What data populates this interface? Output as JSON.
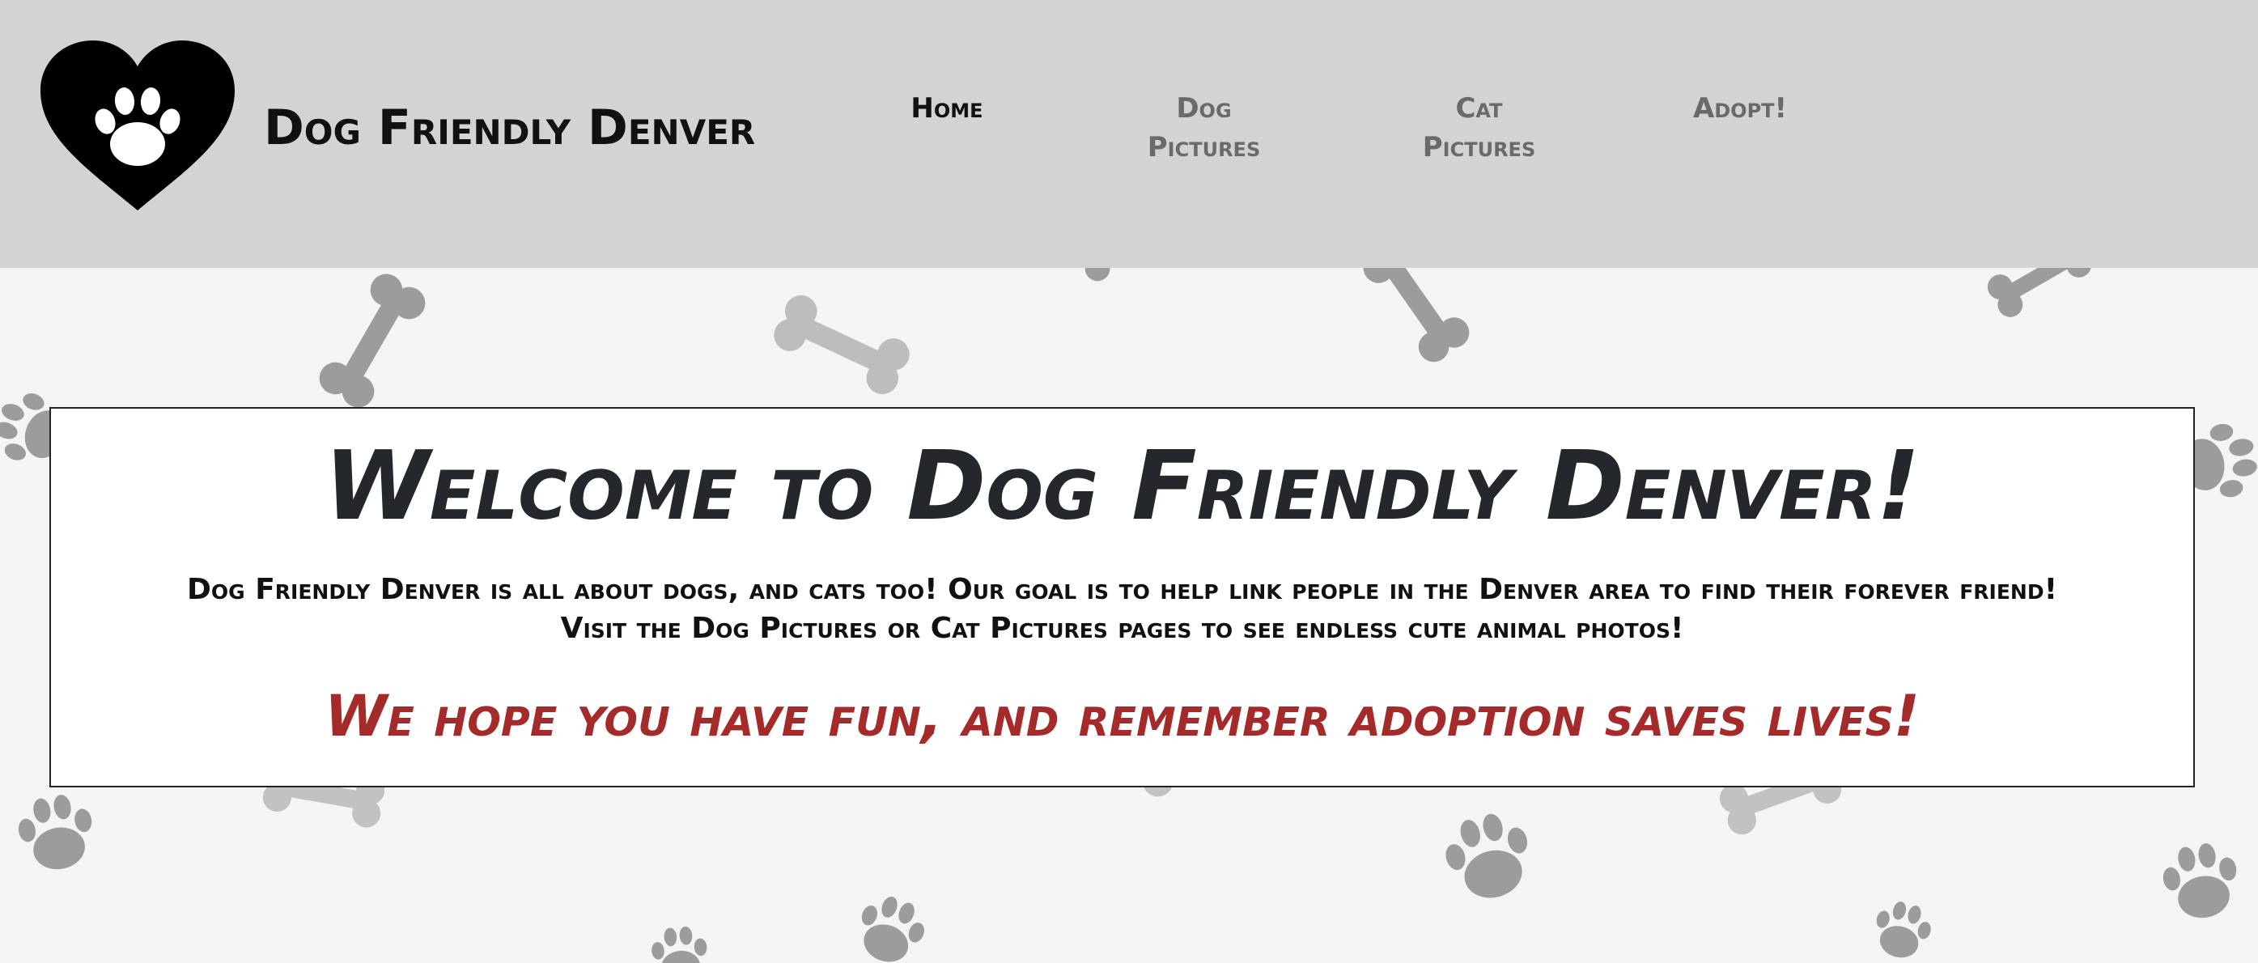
{
  "header": {
    "site_name": "Dog Friendly Denver",
    "logo_icon": "heart-paw-icon",
    "nav": [
      {
        "label": "Home",
        "active": true
      },
      {
        "label": "Dog\nPictures",
        "active": false
      },
      {
        "label": "Cat\nPictures",
        "active": false
      },
      {
        "label": "Adopt!",
        "active": false
      }
    ]
  },
  "welcome": {
    "title": "Welcome to Dog Friendly Denver!",
    "intro": "Dog Friendly Denver is all about dogs, and cats too! Our goal is to help link people in the Denver area to find their forever friend!\nVisit the Dog Pictures or Cat Pictures pages to see endless cute animal photos!",
    "tagline": "We hope you have fun, and remember adoption saves lives!"
  },
  "colors": {
    "header_bg": "#d3d3d3",
    "page_bg": "#f4f4f4",
    "title_text": "#24272b",
    "tagline_text": "#a52a2a",
    "nav_inactive": "#6a6a6a",
    "pattern_shapes": "#9a9a9a"
  },
  "background_pattern": "bones-and-paw-prints"
}
